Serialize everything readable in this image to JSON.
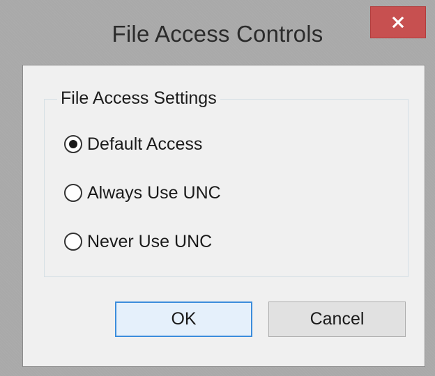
{
  "window": {
    "title": "File Access Controls",
    "close_icon": "close-x-icon"
  },
  "group": {
    "legend": "File Access Settings",
    "options": [
      {
        "label": "Default Access",
        "selected": true
      },
      {
        "label": "Always Use UNC",
        "selected": false
      },
      {
        "label": "Never Use UNC",
        "selected": false
      }
    ]
  },
  "buttons": {
    "ok_label": "OK",
    "cancel_label": "Cancel"
  },
  "colors": {
    "close_button": "#c75050",
    "default_button_border": "#3c8ddc",
    "client_background": "#f0f0f0"
  }
}
